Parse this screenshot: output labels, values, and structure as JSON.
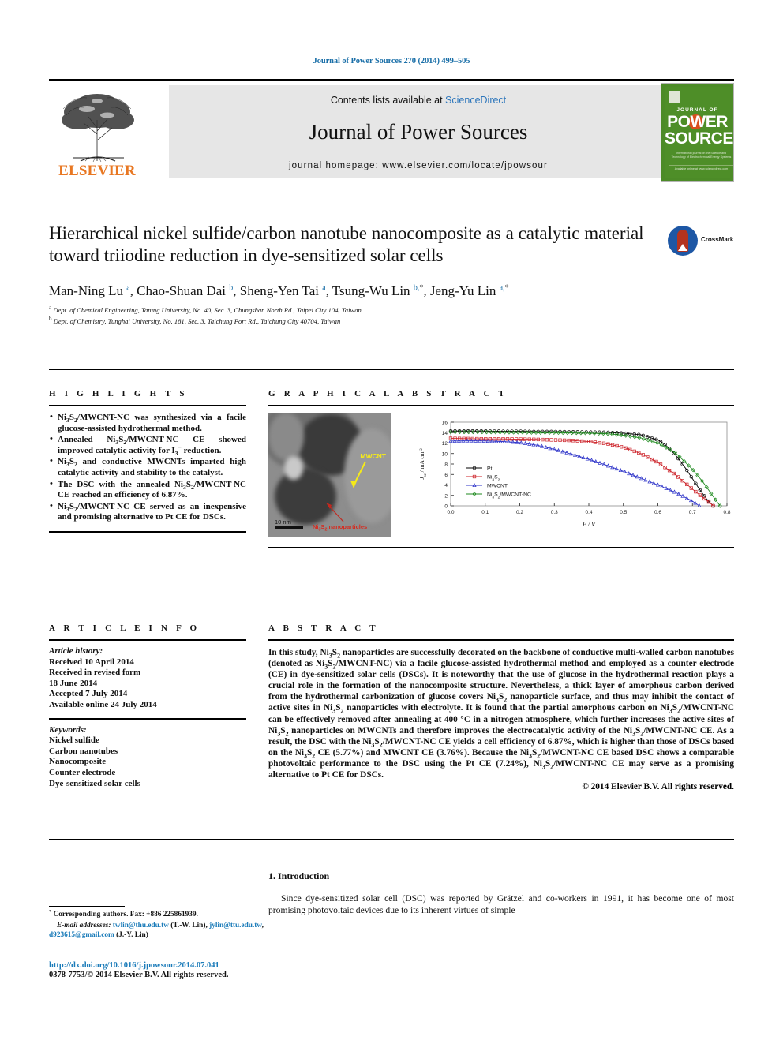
{
  "running_head": "Journal of Power Sources 270 (2014) 499–505",
  "masthead": {
    "contents_prefix": "Contents lists available at ",
    "sciencedirect": "ScienceDirect",
    "journal_title": "Journal of Power Sources",
    "homepage": "journal homepage: www.elsevier.com/locate/jpowsour",
    "publisher_name": "ELSEVIER",
    "cover": {
      "line_top": "JOURNAL OF",
      "line_big1": "POWER",
      "line_big2": "SOURCES",
      "blurb": "International journal on the Science and Technology of Electrochemical Energy Systems",
      "footer": "Available online at www.sciencedirect.com"
    }
  },
  "article": {
    "title": "Hierarchical nickel sulfide/carbon nanotube nanocomposite as a catalytic material toward triiodine reduction in dye-sensitized solar cells",
    "crossmark_label": "CrossMark",
    "authors_html": "Man-Ning Lu <sup>a</sup>, Chao-Shuan Dai <sup>b</sup>, Sheng-Yen Tai <sup>a</sup>, Tsung-Wu Lin <sup>b,</sup><sup class=\"star\">*</sup>, Jeng-Yu Lin <sup>a,</sup><sup class=\"star\">*</sup>",
    "affiliations": [
      "Dept. of Chemical Engineering, Tatung University, No. 40, Sec. 3, Chungshan North Rd., Taipei City 104, Taiwan",
      "Dept. of Chemistry, Tunghai University, No. 181, Sec. 3, Taichung Port Rd., Taichung City 40704, Taiwan"
    ],
    "affiliation_marks": [
      "a",
      "b"
    ]
  },
  "sections": {
    "highlights_head": "H I G H L I G H T S",
    "graphical_abstract_head": "G R A P H I C A L   A B S T R A C T",
    "article_info_head": "A R T I C L E   I N F O",
    "abstract_head": "A B S T R A C T"
  },
  "highlights": [
    "Ni<sub>3</sub>S<sub>2</sub>/MWCNT-NC was synthesized via a facile glucose-assisted hydrothermal method.",
    "Annealed Ni<sub>3</sub>S<sub>2</sub>/MWCNT-NC CE showed improved catalytic activity for I<sub>3</sub><sup>&minus;</sup> reduction.",
    "Ni<sub>3</sub>S<sub>2</sub> and conductive MWCNTs imparted high catalytic activity and stability to the catalyst.",
    "The DSC with the annealed Ni<sub>3</sub>S<sub>2</sub>/MWCNT-NC CE reached an efficiency of 6.87%.",
    "Ni<sub>3</sub>S<sub>2</sub>/MWCNT-NC CE served as an inexpensive and promising alternative to Pt CE for DSCs."
  ],
  "graphical_abstract": {
    "tem_labels": {
      "mwcnt": "MWCNT",
      "nanoparticles_html": "Ni<sub>3</sub>S<sub>2</sub> nanoparticles",
      "scale_bar": "10 nm"
    }
  },
  "chart_data": {
    "type": "line",
    "title": "",
    "xlabel": "E / V",
    "ylabel_html": "J<sub>sc</sub> / mA cm<sup>&minus;2</sup>",
    "xlim": [
      0.0,
      0.8
    ],
    "ylim": [
      0,
      16
    ],
    "xticks": [
      "0.0",
      "0.1",
      "0.2",
      "0.3",
      "0.4",
      "0.5",
      "0.6",
      "0.7",
      "0.8"
    ],
    "yticks": [
      "0",
      "2",
      "4",
      "6",
      "8",
      "10",
      "12",
      "14",
      "16"
    ],
    "grid": false,
    "legend_position": "lower-left",
    "series": [
      {
        "name": "Pt",
        "color": "#000000",
        "marker": "circle-open",
        "x": [
          0.0,
          0.05,
          0.1,
          0.15,
          0.2,
          0.25,
          0.3,
          0.35,
          0.4,
          0.45,
          0.5,
          0.55,
          0.6,
          0.62,
          0.65,
          0.68,
          0.7,
          0.72,
          0.74,
          0.76
        ],
        "y": [
          14.3,
          14.3,
          14.3,
          14.25,
          14.25,
          14.2,
          14.2,
          14.15,
          14.1,
          14.05,
          13.9,
          13.6,
          12.6,
          11.8,
          9.8,
          7.2,
          5.2,
          3.2,
          1.4,
          0.0
        ]
      },
      {
        "name": "Ni3S2",
        "name_html": "Ni<sub>3</sub>S<sub>2</sub>",
        "color": "#cc2027",
        "marker": "square-open",
        "x": [
          0.0,
          0.05,
          0.1,
          0.15,
          0.2,
          0.25,
          0.3,
          0.35,
          0.4,
          0.45,
          0.5,
          0.55,
          0.6,
          0.65,
          0.7,
          0.73,
          0.75,
          0.76
        ],
        "y": [
          12.9,
          12.85,
          12.8,
          12.8,
          12.75,
          12.7,
          12.6,
          12.5,
          12.3,
          11.9,
          11.2,
          10.0,
          8.3,
          6.0,
          3.2,
          1.6,
          0.6,
          0.0
        ]
      },
      {
        "name": "MWCNT",
        "color": "#2f35c9",
        "marker": "triangle-open",
        "x": [
          0.0,
          0.05,
          0.1,
          0.15,
          0.2,
          0.25,
          0.3,
          0.35,
          0.4,
          0.45,
          0.5,
          0.55,
          0.6,
          0.65,
          0.7,
          0.72
        ],
        "y": [
          12.4,
          12.45,
          12.4,
          12.3,
          12.1,
          11.6,
          10.8,
          9.9,
          8.9,
          7.8,
          6.6,
          5.3,
          4.0,
          2.6,
          0.9,
          0.0
        ]
      },
      {
        "name": "Ni3S2/MWCNT-NC",
        "name_html": "Ni<sub>3</sub>S<sub>2</sub>/MWCNT-NC",
        "color": "#1f8a1f",
        "marker": "diamond-open",
        "x": [
          0.0,
          0.05,
          0.1,
          0.15,
          0.2,
          0.25,
          0.3,
          0.35,
          0.4,
          0.45,
          0.5,
          0.55,
          0.6,
          0.65,
          0.7,
          0.73,
          0.76,
          0.78
        ],
        "y": [
          14.1,
          14.1,
          14.1,
          14.05,
          14.05,
          14.0,
          14.0,
          13.95,
          13.9,
          13.8,
          13.5,
          13.0,
          12.0,
          10.2,
          7.0,
          4.6,
          1.8,
          0.0
        ]
      }
    ]
  },
  "article_info": {
    "history_label": "Article history:",
    "history": [
      "Received 10 April 2014",
      "Received in revised form",
      "18 June 2014",
      "Accepted 7 July 2014",
      "Available online 24 July 2014"
    ],
    "keywords_label": "Keywords:",
    "keywords": [
      "Nickel sulfide",
      "Carbon nanotubes",
      "Nanocomposite",
      "Counter electrode",
      "Dye-sensitized solar cells"
    ]
  },
  "abstract": {
    "text_html": "In this study, Ni<sub>3</sub>S<sub>2</sub> nanoparticles are successfully decorated on the backbone of conductive multi-walled carbon nanotubes (denoted as Ni<sub>3</sub>S<sub>2</sub>/MWCNT-NC) via a facile glucose-assisted hydrothermal method and employed as a counter electrode (CE) in dye-sensitized solar cells (DSCs). It is noteworthy that the use of glucose in the hydrothermal reaction plays a crucial role in the formation of the nanocomposite structure. Nevertheless, a thick layer of amorphous carbon derived from the hydrothermal carbonization of glucose covers Ni<sub>3</sub>S<sub>2</sub> nanoparticle surface, and thus may inhibit the contact of active sites in Ni<sub>3</sub>S<sub>2</sub> nanoparticles with electrolyte. It is found that the partial amorphous carbon on Ni<sub>3</sub>S<sub>2</sub>/MWCNT-NC can be effectively removed after annealing at 400 &deg;C in a nitrogen atmosphere, which further increases the active sites of Ni<sub>3</sub>S<sub>2</sub> nanoparticles on MWCNTs and therefore improves the electrocatalytic activity of the Ni<sub>3</sub>S<sub>2</sub>/MWCNT-NC CE. As a result, the DSC with the Ni<sub>3</sub>S<sub>2</sub>/MWCNT-NC CE yields a cell efficiency of 6.87%, which is higher than those of DSCs based on the Ni<sub>3</sub>S<sub>2</sub> CE (5.77%) and MWCNT CE (3.76%). Because the Ni<sub>3</sub>S<sub>2</sub>/MWCNT-NC CE based DSC shows a comparable photovoltaic performance to the DSC using the Pt CE (7.24%), Ni<sub>3</sub>S<sub>2</sub>/MWCNT-NC CE may serve as a promising alternative to Pt CE for DSCs.",
    "copyright": "© 2014 Elsevier B.V. All rights reserved."
  },
  "footnote": {
    "corresponding_html": "<sup>*</sup> Corresponding authors. Fax: +886 225861939.",
    "email_label": "E-mail addresses:",
    "emails": [
      {
        "address": "twlin@thu.edu.tw",
        "who": "(T.-W. Lin)"
      },
      {
        "address": "jylin@ttu.edu.tw",
        "who": ""
      },
      {
        "address": "d923615@gmail.com",
        "who": "(J.-Y. Lin)"
      }
    ]
  },
  "doi": {
    "url": "http://dx.doi.org/10.1016/j.jpowsour.2014.07.041",
    "issn_line": "0378-7753/© 2014 Elsevier B.V. All rights reserved."
  },
  "introduction": {
    "heading": "1. Introduction",
    "paragraph": "Since dye-sensitized solar cell (DSC) was reported by Grätzel and co-workers in 1991, it has become one of most promising photovoltaic devices due to its inherent virtues of simple"
  }
}
